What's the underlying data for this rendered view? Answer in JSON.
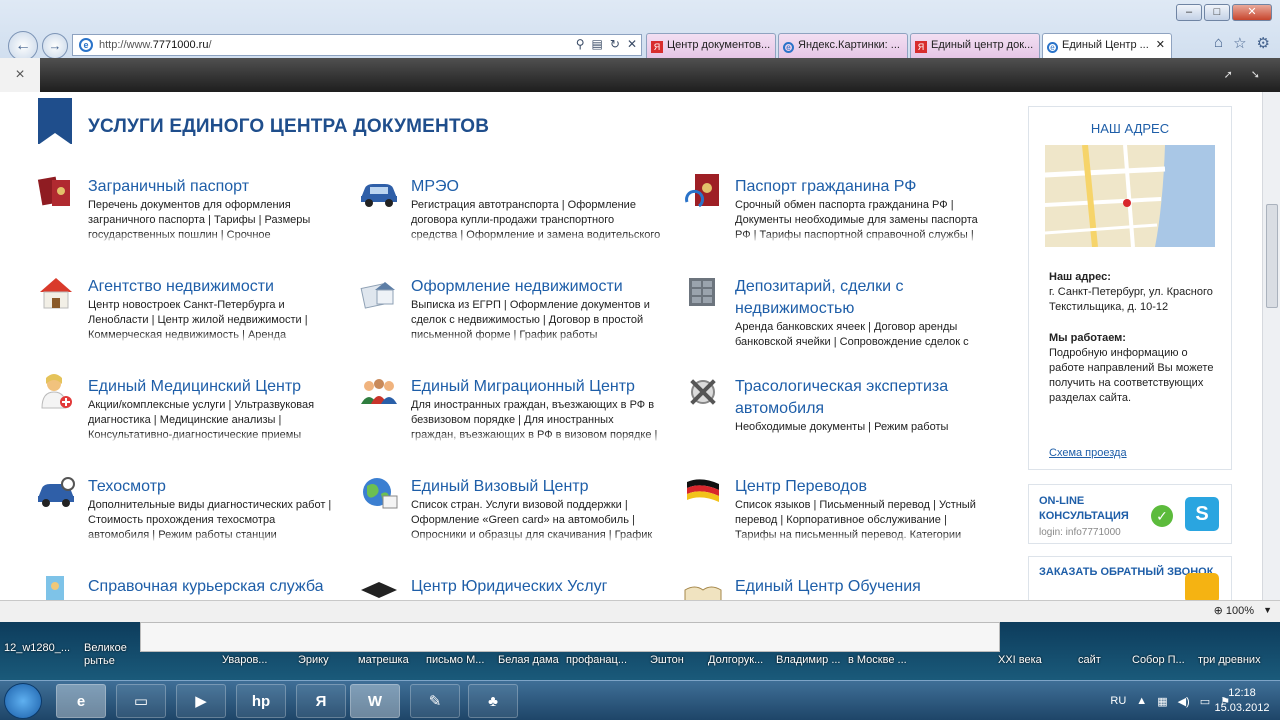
{
  "browser": {
    "url_prefix": "http://www.",
    "url_domain": "7771000.ru",
    "url_suffix": "/",
    "tabs": [
      {
        "label": "Центр документов..."
      },
      {
        "label": "Яндекс.Картинки: ..."
      },
      {
        "label": "Единый центр док..."
      },
      {
        "label": "Единый Центр ..."
      }
    ],
    "zoom": "100%"
  },
  "page": {
    "title": "УСЛУГИ ЕДИНОГО ЦЕНТРА ДОКУМЕНТОВ",
    "services": [
      {
        "title": "Заграничный паспорт",
        "desc": "Перечень документов для оформления заграничного паспорта | Тарифы | Размеры государственных пошлин | Срочное оформление загранпаспорта | График работы"
      },
      {
        "title": "МРЭО",
        "desc": "Регистрация автотранспорта | Оформление договора купли-продажи транспортного средства | Оформление и замена водительского удостоверения | Услуги"
      },
      {
        "title": "Паспорт гражданина РФ",
        "desc": "Срочный обмен паспорта гражданина РФ | Документы необходимые для замены паспорта РФ | Тарифы паспортной справочной службы | График работы паспортного стола"
      },
      {
        "title": "Агентство недвижимости",
        "desc": "Центр новостроек Санкт-Петербурга и Ленобласти | Центр жилой недвижимости | Коммерческая недвижимость | Аренда недвижимости | Загородная недвижимость |"
      },
      {
        "title": "Оформление недвижимости",
        "desc": "Выписка из ЕГРП | Оформление документов и сделок с недвижимостью | Договор в простой письменной форме | График работы"
      },
      {
        "title": "Депозитарий, сделки с недвижимостью",
        "desc": "Аренда банковских ячеек | Договор аренды банковской ячейки | Сопровождение сделок с"
      },
      {
        "title": "Единый Медицинский Центр",
        "desc": "Акции/комплексные услуги | Ультразвуковая диагностика | Медицинские анализы | Консультативно-диагностические приемы врачей | Функциональная диагностика |"
      },
      {
        "title": "Единый Миграционный Центр",
        "desc": "Для иностранных граждан, въезжающих в РФ в безвизовом порядке | Для иностранных граждан, въезжающих в РФ в визовом порядке | Для иностранных граждан"
      },
      {
        "title": "Трасологическая экспертиза автомобиля",
        "desc": "Необходимые документы | Режим работы"
      },
      {
        "title": "Техосмотр",
        "desc": "Дополнительные виды диагностических работ | Стоимость прохождения техосмотра автомобиля | Режим работы станции техосмотра"
      },
      {
        "title": "Единый Визовый Центр",
        "desc": "Список стран. Услуги визовой поддержки | Оформление «Green card» на автомобиль | Опросники и образцы для скачивания | График работы"
      },
      {
        "title": "Центр Переводов",
        "desc": "Список языков | Письменный перевод | Устный перевод | Корпоративное обслуживание | Тарифы на письменный перевод. Категории срочности. Категории сложности | Адрес и"
      },
      {
        "title": "Справочная курьерская служба",
        "desc": ""
      },
      {
        "title": "Центр Юридических Услуг",
        "desc": ""
      },
      {
        "title": "Единый Центр Обучения",
        "desc": ""
      }
    ]
  },
  "sidebar": {
    "address_heading": "НАШ АДРЕС",
    "address_label": "Наш адрес:",
    "address_text": "г. Санкт-Петербург, ул. Красного Текстильщика, д. 10-12",
    "hours_label": "Мы работаем:",
    "hours_text": "Подробную информацию о работе направлений Вы можете получить на соответствующих разделах сайта.",
    "route_link": "Схема проезда",
    "consult_title": "ON-LINE КОНСУЛЬТАЦИЯ",
    "consult_login": "login: info7771000",
    "callback_title": "ЗАКАЗАТЬ ОБРАТНЫЙ ЗВОНОК"
  },
  "desktop": {
    "labels": [
      "12_w1280_...",
      "Великое рытье",
      "Уваров...",
      "Эрику",
      "матрешка",
      "письмо М...",
      "Белая дама",
      "профанац...",
      "Эштон",
      "Долгорук...",
      "Владимир ...",
      "в Москве ...",
      "XXI века",
      "сайт",
      "Собор П...",
      "три древних"
    ]
  },
  "taskbar": {
    "lang": "RU",
    "time": "12:18",
    "date": "15.03.2012"
  },
  "colors": {
    "accent": "#1e5ea8",
    "bookmark": "#1f4e8c"
  }
}
